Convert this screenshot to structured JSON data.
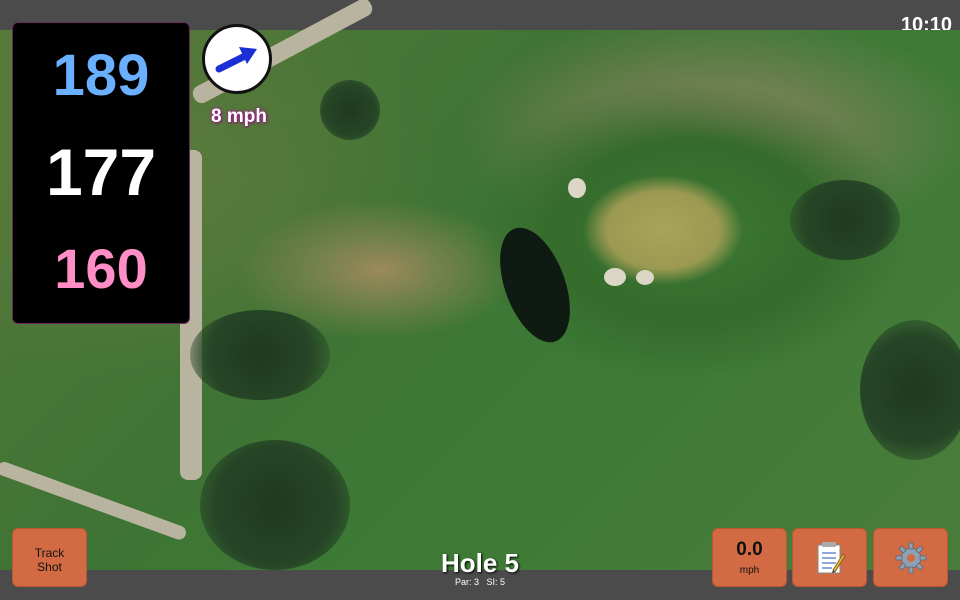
{
  "status": {
    "time": "10:10"
  },
  "distances": {
    "back": "189",
    "middle": "177",
    "front": "160"
  },
  "colors": {
    "back": "#6ab0ff",
    "middle": "#ffffff",
    "front": "#ff8dc6",
    "button": "#d26b43",
    "wind_arrow": "#1a2fd6"
  },
  "wind": {
    "speed_label": "8 mph",
    "icon": "wind-direction-arrow-icon"
  },
  "buttons": {
    "track_shot_line1": "Track",
    "track_shot_line2": "Shot",
    "speed_value": "0.0",
    "speed_unit": "mph",
    "notes_icon": "notepad-icon",
    "settings_icon": "gear-icon"
  },
  "hole": {
    "title": "Hole 5",
    "par_label": "Par: 3",
    "si_label": "SI: 5"
  }
}
